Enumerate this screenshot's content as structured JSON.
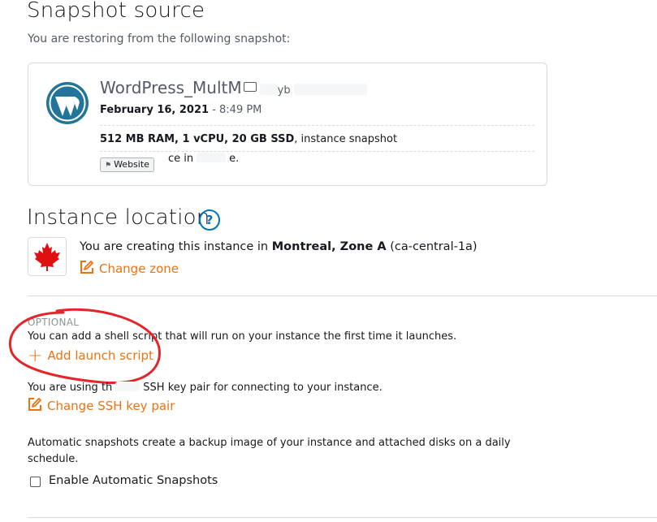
{
  "snapshot_source": {
    "title": "Snapshot source",
    "subtitle": "You are restoring from the following snapshot:",
    "card": {
      "name": "WordPress_MultM",
      "name_tail": "yb",
      "date": "February 16, 2021",
      "time": " - 8:49 PM",
      "specs_bold": "512 MB RAM, 1 vCPU, 20 GB SSD",
      "specs_rest": ", instance snapshot",
      "tag": "Website",
      "location_a": "ce in",
      "location_b": "e."
    }
  },
  "instance_location": {
    "title": "Instance location",
    "help_glyph": "?",
    "text_prefix": "You are creating this instance in ",
    "region_bold": "Montreal, Zone A",
    "region_code": " (ca-central-1a)",
    "change_zone": "Change zone"
  },
  "launch_script": {
    "optional_label": "OPTIONAL",
    "description": "You can add a shell script that will run on your instance the first time it launches.",
    "add_label": "Add launch script"
  },
  "ssh": {
    "text_a": "You are using th",
    "text_b": "SSH key pair for connecting to your instance.",
    "change_label": "Change SSH key pair"
  },
  "auto_snapshots": {
    "description_line1": "Automatic snapshots create a backup image of your instance and attached disks on a daily",
    "description_line2": "schedule.",
    "checkbox_label": "Enable Automatic Snapshots",
    "checked": false
  },
  "colors": {
    "link": "#ec7211",
    "help": "#0073bb",
    "annotation": "#e3262a",
    "wordpress": "#21759b",
    "flag": "#e01010"
  }
}
